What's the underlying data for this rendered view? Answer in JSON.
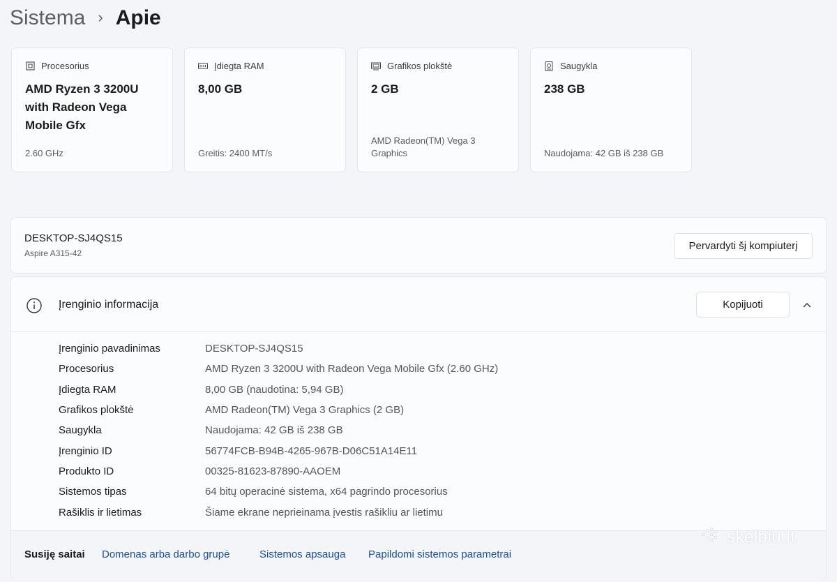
{
  "breadcrumb": {
    "parent": "Sistema",
    "separator": "›",
    "current": "Apie"
  },
  "specs_cards": [
    {
      "icon": "processor-icon",
      "label": "Procesorius",
      "value": "AMD Ryzen 3 3200U with Radeon Vega Mobile Gfx",
      "sub": "2.60 GHz"
    },
    {
      "icon": "ram-icon",
      "label": "Įdiegta RAM",
      "value": "8,00 GB",
      "sub": "Greitis: 2400 MT/s"
    },
    {
      "icon": "graphics-card-icon",
      "label": "Grafikos plokštė",
      "value": "2 GB",
      "sub": "AMD Radeon(TM) Vega 3 Graphics"
    },
    {
      "icon": "storage-icon",
      "label": "Saugykla",
      "value": "238 GB",
      "sub": "Naudojama: 42 GB iš 238 GB"
    }
  ],
  "device": {
    "name": "DESKTOP-SJ4QS15",
    "model": "Aspire A315-42",
    "rename_button": "Pervardyti šį kompiuterį"
  },
  "device_info": {
    "title": "Įrenginio informacija",
    "copy_button": "Kopijuoti",
    "rows": [
      {
        "key": "Įrenginio pavadinimas",
        "value": "DESKTOP-SJ4QS15"
      },
      {
        "key": "Procesorius",
        "value": "AMD Ryzen 3 3200U with Radeon Vega Mobile Gfx (2.60 GHz)"
      },
      {
        "key": "Įdiegta RAM",
        "value": "8,00 GB (naudotina: 5,94 GB)"
      },
      {
        "key": "Grafikos plokštė",
        "value": "AMD Radeon(TM) Vega 3 Graphics (2 GB)"
      },
      {
        "key": "Saugykla",
        "value": "Naudojama: 42 GB iš 238 GB"
      },
      {
        "key": "Įrenginio ID",
        "value": "56774FCB-B94B-4265-967B-D06C51A14E11"
      },
      {
        "key": "Produkto ID",
        "value": "00325-81623-87890-AAOEM"
      },
      {
        "key": "Sistemos tipas",
        "value": "64 bitų operacinė sistema, x64 pagrindo procesorius"
      },
      {
        "key": "Rašiklis ir lietimas",
        "value": "Šiame ekrane neprieinama įvestis rašikliu ar lietimu"
      }
    ]
  },
  "related_links": {
    "label": "Susiję saitai",
    "links": [
      "Domenas arba darbo grupė",
      "Sistemos apsauga",
      "Papildomi sistemos parametrai"
    ]
  },
  "watermark": "skelbiu.lt",
  "colors": {
    "link": "#1a4fa0",
    "card_bg": "#fbfcfd",
    "page_bg": "#f3f5f9"
  }
}
